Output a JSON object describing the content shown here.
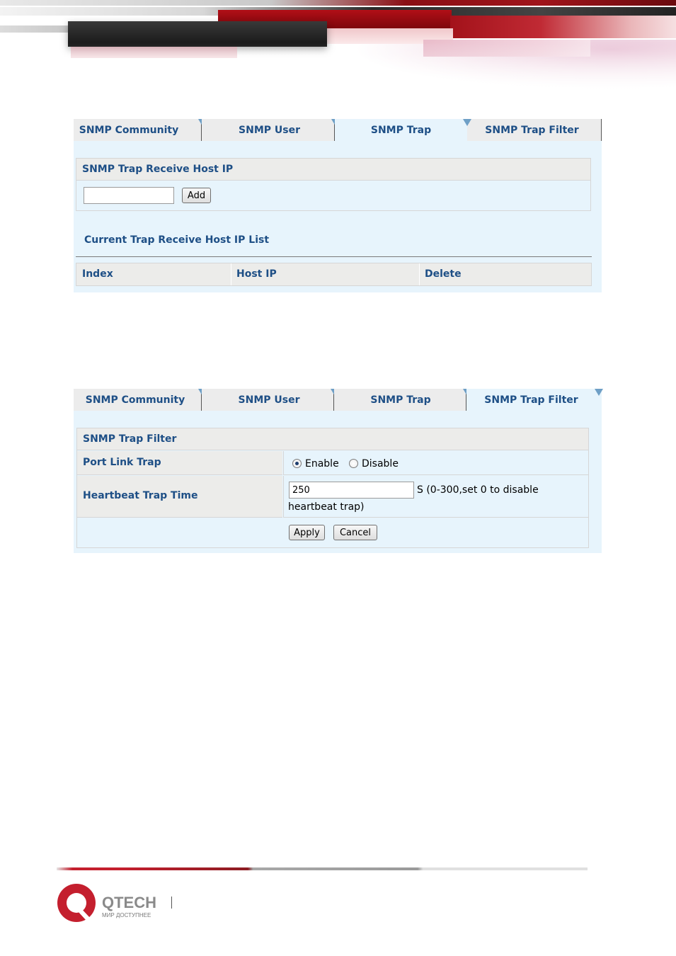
{
  "colors": {
    "link_blue": "#1e4f86",
    "panel_bg": "#e7f4fc",
    "header_bg": "#ececea",
    "brand_red": "#c41f2e"
  },
  "panel1": {
    "tabs": [
      {
        "label": "SNMP Community"
      },
      {
        "label": "SNMP User"
      },
      {
        "label": "SNMP Trap"
      },
      {
        "label": "SNMP Trap Filter"
      }
    ],
    "active_tab": "SNMP Trap",
    "receive_host": {
      "title": "SNMP Trap Receive Host IP",
      "ip_value": "",
      "add_label": "Add"
    },
    "list_title": "Current Trap Receive Host IP List",
    "columns": [
      "Index",
      "Host IP",
      "Delete"
    ]
  },
  "panel2": {
    "tabs": [
      {
        "label": "SNMP Community"
      },
      {
        "label": "SNMP User"
      },
      {
        "label": "SNMP Trap"
      },
      {
        "label": "SNMP Trap Filter"
      }
    ],
    "active_tab": "SNMP Trap Filter",
    "filter": {
      "title": "SNMP Trap Filter",
      "port_link_label": "Port Link Trap",
      "enable_label": "Enable",
      "disable_label": "Disable",
      "port_link_value": "Enable",
      "heartbeat_label": "Heartbeat Trap Time",
      "heartbeat_value": "250",
      "heartbeat_hint1": "S (0-300,set 0 to disable",
      "heartbeat_hint2": "heartbeat trap)",
      "apply_label": "Apply",
      "cancel_label": "Cancel"
    }
  },
  "footer": {
    "logo_text": "QTECH",
    "logo_tagline": "МИР ДОСТУПНЕЕ"
  }
}
